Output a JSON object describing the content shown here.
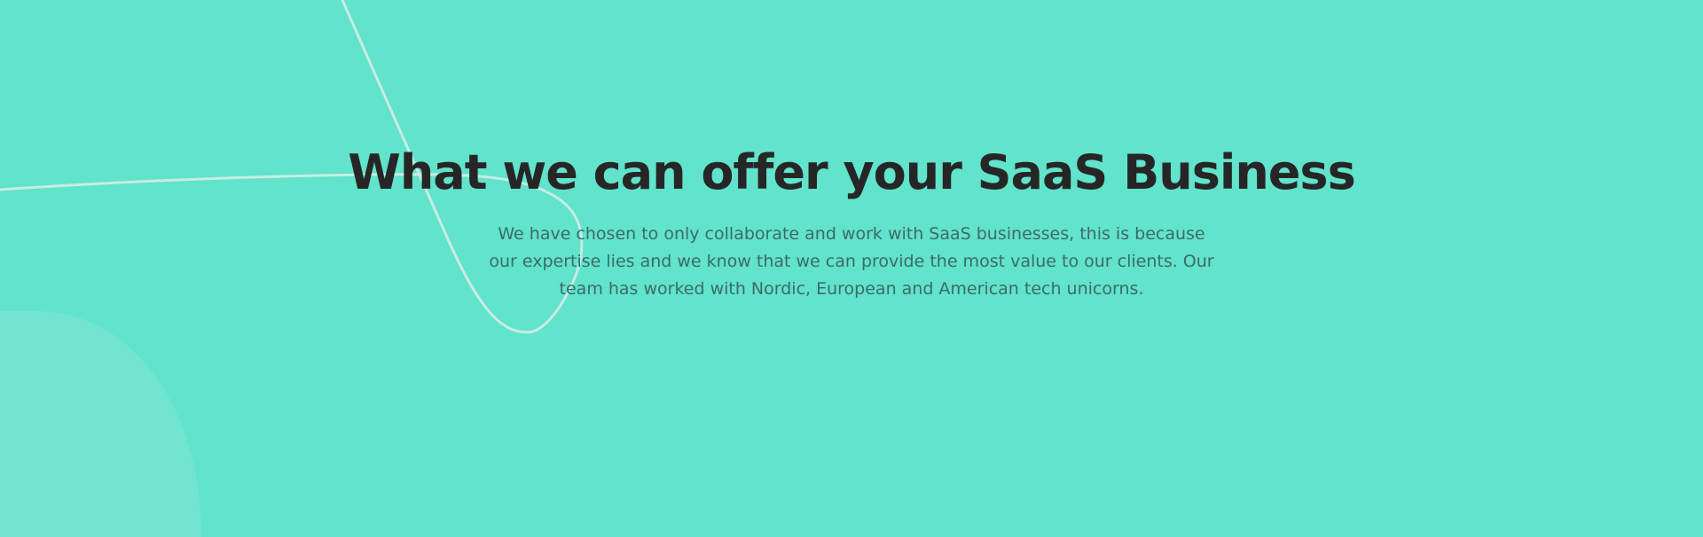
{
  "theme": {
    "background": "#61e3cc",
    "heading_color": "#262626",
    "text_color": "#3d6b64",
    "line_color": "#c9ece4",
    "blob_color": "#72e5d1"
  },
  "hero": {
    "title": "What we can offer your SaaS Business",
    "description": "We have chosen to only collaborate and work with SaaS businesses, this is because our expertise lies and we know that we can provide the most value to our clients. Our team has worked with Nordic, European and American tech unicorns."
  }
}
